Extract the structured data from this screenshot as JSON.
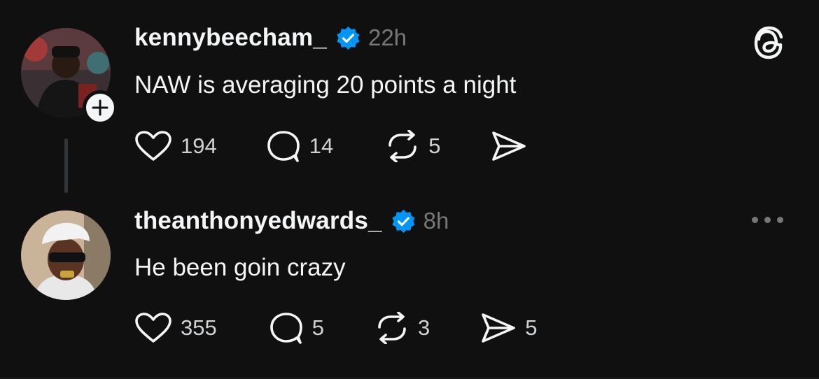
{
  "posts": [
    {
      "username": "kennybeecham_",
      "time": "22h",
      "text": "NAW is averaging 20 points a night",
      "likes": "194",
      "replies": "14",
      "reposts": "5",
      "shares": ""
    },
    {
      "username": "theanthonyedwards_",
      "time": "8h",
      "text": "He been goin crazy",
      "likes": "355",
      "replies": "5",
      "reposts": "3",
      "shares": "5"
    }
  ],
  "icons": {
    "like": "heart-icon",
    "reply": "comment-icon",
    "repost": "repost-icon",
    "share": "send-icon",
    "verified": "verified-badge-icon",
    "logo": "threads-logo-icon",
    "more": "more-horizontal-icon",
    "follow": "plus-icon"
  },
  "colors": {
    "background": "#101010",
    "text": "#f3f5f7",
    "muted": "#777777",
    "verified": "#0095f6"
  }
}
